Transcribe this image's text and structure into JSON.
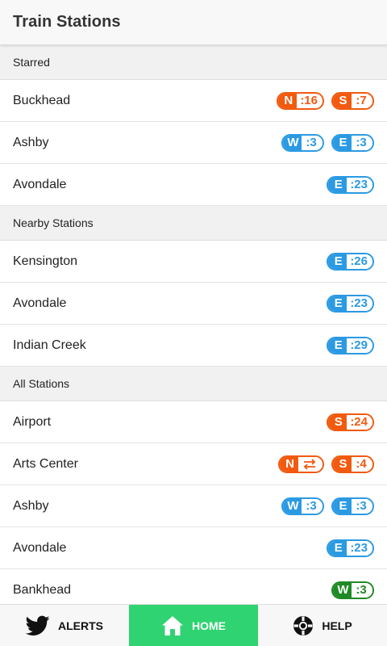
{
  "app": {
    "title": "Train Stations"
  },
  "colors": {
    "orange": "#f15a0f",
    "blue": "#2b9ae3",
    "green": "#1f8a24",
    "nav_active": "#2fd371"
  },
  "sections": [
    {
      "title": "Starred",
      "stations": [
        {
          "name": "Buckhead",
          "badges": [
            {
              "dir": "N",
              "time": ":16",
              "color": "orange"
            },
            {
              "dir": "S",
              "time": ":7",
              "color": "orange"
            }
          ]
        },
        {
          "name": "Ashby",
          "badges": [
            {
              "dir": "W",
              "time": ":3",
              "color": "blue"
            },
            {
              "dir": "E",
              "time": ":3",
              "color": "blue"
            }
          ]
        },
        {
          "name": "Avondale",
          "badges": [
            {
              "dir": "E",
              "time": ":23",
              "color": "blue"
            }
          ]
        }
      ]
    },
    {
      "title": "Nearby Stations",
      "stations": [
        {
          "name": "Kensington",
          "badges": [
            {
              "dir": "E",
              "time": ":26",
              "color": "blue"
            }
          ]
        },
        {
          "name": "Avondale",
          "badges": [
            {
              "dir": "E",
              "time": ":23",
              "color": "blue"
            }
          ]
        },
        {
          "name": "Indian Creek",
          "badges": [
            {
              "dir": "E",
              "time": ":29",
              "color": "blue"
            }
          ]
        }
      ]
    },
    {
      "title": "All Stations",
      "stations": [
        {
          "name": "Airport",
          "badges": [
            {
              "dir": "S",
              "time": ":24",
              "color": "orange"
            }
          ]
        },
        {
          "name": "Arts Center",
          "badges": [
            {
              "dir": "N",
              "time": "",
              "icon": "swap-arrows-icon",
              "color": "orange"
            },
            {
              "dir": "S",
              "time": ":4",
              "color": "orange"
            }
          ]
        },
        {
          "name": "Ashby",
          "badges": [
            {
              "dir": "W",
              "time": ":3",
              "color": "blue"
            },
            {
              "dir": "E",
              "time": ":3",
              "color": "blue"
            }
          ]
        },
        {
          "name": "Avondale",
          "badges": [
            {
              "dir": "E",
              "time": ":23",
              "color": "blue"
            }
          ]
        },
        {
          "name": "Bankhead",
          "badges": [
            {
              "dir": "W",
              "time": ":3",
              "color": "green"
            }
          ]
        }
      ]
    }
  ],
  "nav": {
    "items": [
      {
        "label": "ALERTS",
        "icon": "twitter-bird-icon",
        "active": false
      },
      {
        "label": "HOME",
        "icon": "home-icon",
        "active": true
      },
      {
        "label": "HELP",
        "icon": "lifebuoy-icon",
        "active": false
      }
    ]
  }
}
